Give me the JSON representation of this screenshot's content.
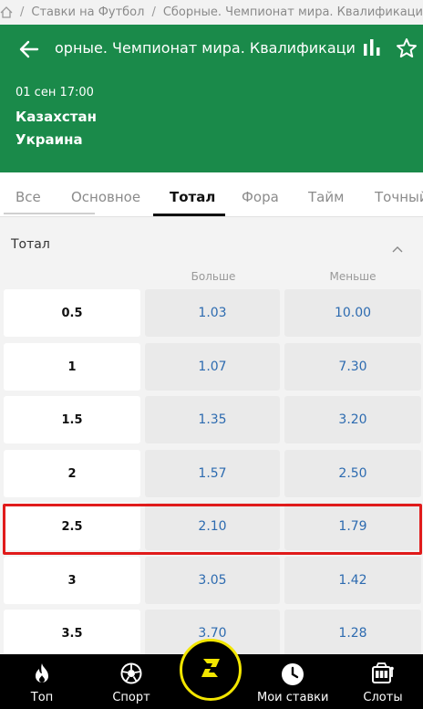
{
  "breadcrumb": {
    "items": [
      "Ставки на Футбол",
      "Сборные. Чемпионат мира. Квалификация. Евр"
    ]
  },
  "header": {
    "title": "орные. Чемпионат мира. Квалификация. Евро",
    "date": "01 сен 17:00",
    "team1": "Казахстан",
    "team2": "Украина"
  },
  "tabs": [
    "Все",
    "Основное",
    "Тотал",
    "Фора",
    "Тайм",
    "Точный"
  ],
  "active_tab": "Тотал",
  "section": {
    "title": "Тотал",
    "col_over": "Больше",
    "col_under": "Меньше"
  },
  "rows": [
    {
      "line": "0.5",
      "over": "1.03",
      "under": "10.00"
    },
    {
      "line": "1",
      "over": "1.07",
      "under": "7.30"
    },
    {
      "line": "1.5",
      "over": "1.35",
      "under": "3.20"
    },
    {
      "line": "2",
      "over": "1.57",
      "under": "2.50"
    },
    {
      "line": "2.5",
      "over": "2.10",
      "under": "1.79"
    },
    {
      "line": "3",
      "over": "3.05",
      "under": "1.42"
    },
    {
      "line": "3.5",
      "over": "3.70",
      "under": "1.28"
    }
  ],
  "highlighted_row": "2.5",
  "bottom_nav": {
    "top": "Топ",
    "sport": "Спорт",
    "my_bets": "Мои ставки",
    "slots": "Слоты"
  },
  "colors": {
    "header_bg": "#1a8a4a",
    "odds_text": "#2d6bb0",
    "highlight": "#e01b1b",
    "center_button_ring": "#f3e600"
  }
}
